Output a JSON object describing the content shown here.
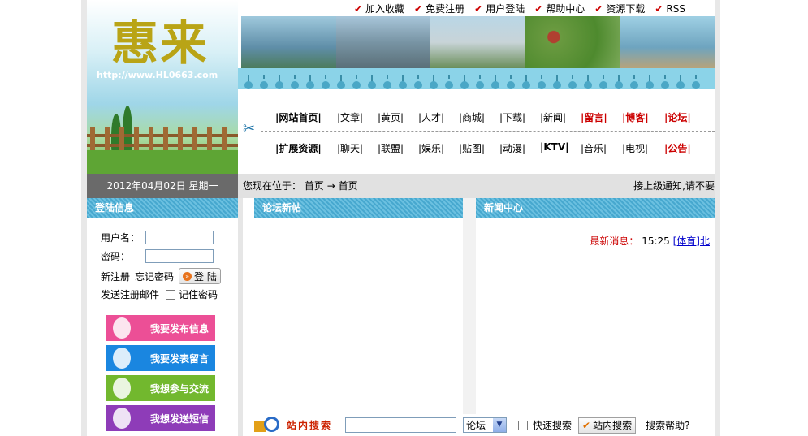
{
  "site": {
    "logo": "惠来",
    "url": "http://www.HL0663.com"
  },
  "top_links": [
    "加入收藏",
    "免费注册",
    "用户登陆",
    "帮助中心",
    "资源下载",
    "RSS"
  ],
  "nav_row1": [
    {
      "label": "|网站首页|",
      "style": "bold"
    },
    {
      "label": "|文章|",
      "style": ""
    },
    {
      "label": "|黄页|",
      "style": ""
    },
    {
      "label": "|人才|",
      "style": ""
    },
    {
      "label": "|商城|",
      "style": ""
    },
    {
      "label": "|下载|",
      "style": ""
    },
    {
      "label": "|新闻|",
      "style": ""
    },
    {
      "label": "|留言|",
      "style": "red"
    },
    {
      "label": "|博客|",
      "style": "red"
    },
    {
      "label": "|论坛|",
      "style": "red"
    }
  ],
  "nav_row2": [
    {
      "label": "|扩展资源|",
      "style": "bold"
    },
    {
      "label": "|聊天|",
      "style": ""
    },
    {
      "label": "|联盟|",
      "style": ""
    },
    {
      "label": "|娱乐|",
      "style": ""
    },
    {
      "label": "|贴图|",
      "style": ""
    },
    {
      "label": "|动漫|",
      "style": ""
    },
    {
      "label": "|KTV|",
      "style": "bold"
    },
    {
      "label": "|音乐|",
      "style": ""
    },
    {
      "label": "|电视|",
      "style": ""
    },
    {
      "label": "|公告|",
      "style": "red"
    }
  ],
  "date_text": "2012年04月02日 星期一",
  "location": {
    "prefix": "您现在位于：",
    "home": "首页",
    "arrow": "→",
    "current": "首页"
  },
  "notice": "接上级通知,请不要",
  "login": {
    "title": "登陆信息",
    "username_label": "用户名：",
    "password_label": "密码：",
    "register": "新注册",
    "forgot": "忘记密码",
    "login_btn": "登 陆",
    "send_mail": "发送注册邮件",
    "remember": "记住密码"
  },
  "promos": [
    "我要发布信息",
    "我要发表留言",
    "我想参与交流",
    "我想发送短信"
  ],
  "forum_panel": {
    "title": "论坛新帖"
  },
  "news_panel": {
    "title": "新闻中心",
    "latest_label": "最新消息：",
    "time": "15:25",
    "link": "[体育]北"
  },
  "search": {
    "title": "站内搜索",
    "select_value": "论坛",
    "quick": "快速搜索",
    "button": "站内搜索",
    "help": "搜索帮助?"
  },
  "colors": {
    "accent_blue": "#47a8cf",
    "red": "#cc0000",
    "logo_gold": "#b9a416",
    "date_bar": "#6a6a6a"
  }
}
